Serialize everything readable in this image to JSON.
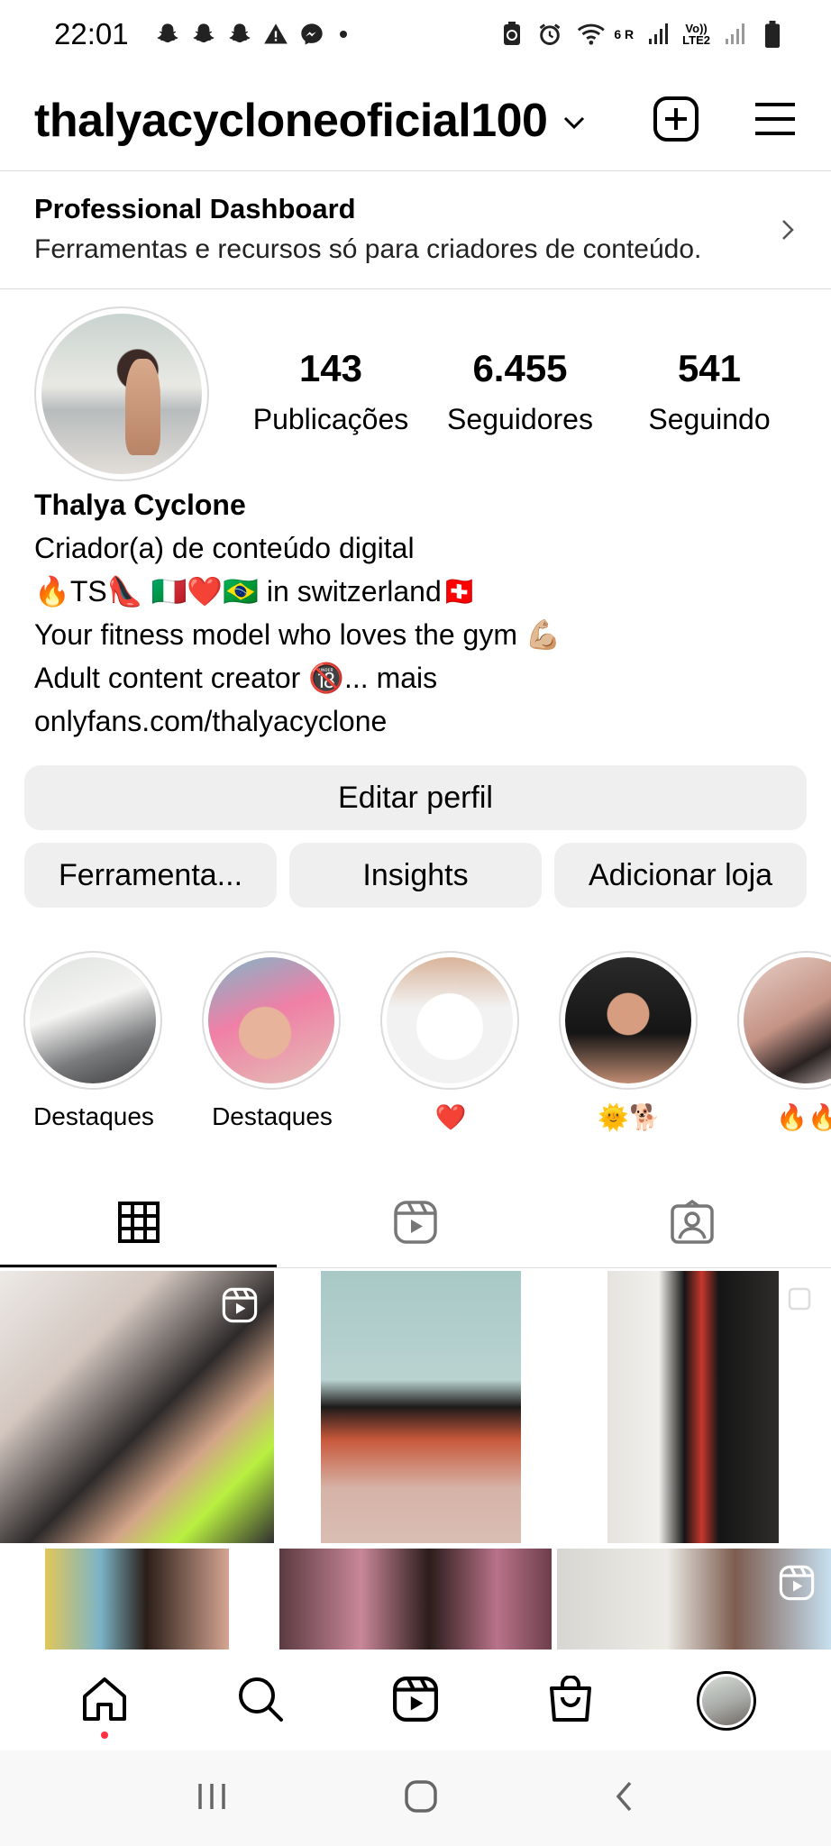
{
  "status_bar": {
    "time": "22:01",
    "signal_label": "6 R",
    "lte_top": "Vo))",
    "lte_bottom": "LTE2"
  },
  "header": {
    "username": "thalyacycloneoficial100"
  },
  "dashboard": {
    "title": "Professional Dashboard",
    "subtitle": "Ferramentas e recursos só para criadores de conteúdo."
  },
  "stats": [
    {
      "value": "143",
      "label": "Publicações"
    },
    {
      "value": "6.455",
      "label": "Seguidores"
    },
    {
      "value": "541",
      "label": "Seguindo"
    }
  ],
  "bio": {
    "name": "Thalya Cyclone",
    "category": "Criador(a) de conteúdo digital",
    "line1": "🔥TS👠 🇮🇹❤️🇧🇷  in switzerland🇨🇭",
    "line2": "Your fitness model who loves the gym 💪🏼",
    "line3": "Adult content creator 🔞... mais",
    "link": "onlyfans.com/thalyacyclone"
  },
  "buttons": {
    "edit_profile": "Editar perfil",
    "tools": "Ferramenta...",
    "insights": "Insights",
    "add_shop": "Adicionar loja"
  },
  "highlights": [
    {
      "label": "Destaques"
    },
    {
      "label": "Destaques"
    },
    {
      "label": "❤️"
    },
    {
      "label": "🌞🐕"
    },
    {
      "label": "🔥🔥"
    }
  ],
  "colors": {
    "notification_dot": "#ff3040",
    "button_bg": "#efefef",
    "divider": "#dbdbdb"
  }
}
